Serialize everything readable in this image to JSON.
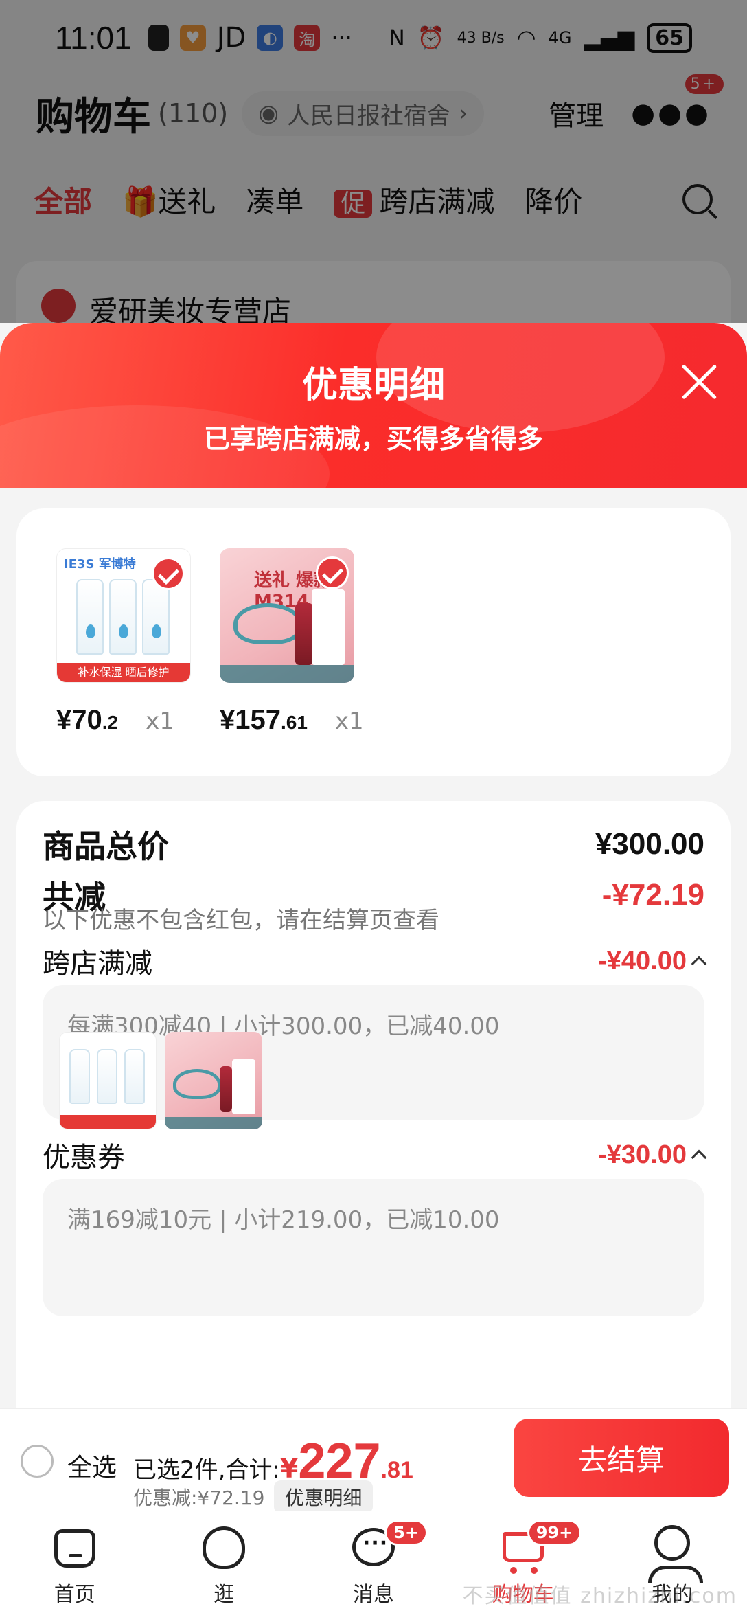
{
  "status_bar": {
    "time": "11:01",
    "app_icons": [
      "JD"
    ],
    "network_speed": "43 B/s",
    "network_type": "4G",
    "battery": "65"
  },
  "cart_header": {
    "title": "购物车",
    "count": "(110)",
    "location": "人民日报社宿舍",
    "manage_label": "管理",
    "more_badge": "5+"
  },
  "cart_tabs": [
    {
      "label": "全部",
      "active": true
    },
    {
      "label": "送礼"
    },
    {
      "label": "凑单"
    },
    {
      "label": "跨店满减",
      "chip": "促"
    },
    {
      "label": "降价"
    }
  ],
  "background_shop": {
    "name": "爱研美妆专营店"
  },
  "sheet": {
    "title": "优惠明细",
    "subtitle": "已享跨店满减，买得多省得多"
  },
  "products": [
    {
      "image": "lotion-tubes",
      "brand_text": "IE3S 军博特",
      "strip_text": "补水保湿 晒后修护",
      "price_int": "¥70",
      "price_dec": ".2",
      "qty": "x1",
      "checked": true
    },
    {
      "image": "lipstick-gift",
      "title_text": "送礼 爆款M314",
      "price_int": "¥157",
      "price_dec": ".61",
      "qty": "x1",
      "checked": true
    }
  ],
  "summary": {
    "total_label": "商品总价",
    "total_value": "¥300.00",
    "reduce_label": "共减",
    "reduce_value": "-¥72.19",
    "note": "以下优惠不包含红包，请在结算页查看"
  },
  "discounts": [
    {
      "label": "跨店满减",
      "value": "-¥40.00",
      "detail": "每满300减40 | 小计300.00，已减40.00"
    },
    {
      "label": "优惠券",
      "value": "-¥30.00",
      "detail": "满169减10元 | 小计219.00，已减10.00"
    }
  ],
  "checkout": {
    "select_all_label": "全选",
    "selected_text": "已选2件,合计:",
    "total_yen": "¥",
    "total_int": "227",
    "total_dec": ".81",
    "saved_text": "优惠减:¥72.19",
    "detail_chip": "优惠明细",
    "button_label": "去结算"
  },
  "bottom_nav": [
    {
      "label": "首页",
      "icon": "home-icon"
    },
    {
      "label": "逛",
      "icon": "stroll-icon"
    },
    {
      "label": "消息",
      "icon": "message-icon",
      "badge": "5+"
    },
    {
      "label": "购物车",
      "icon": "cart-icon",
      "badge": "99+",
      "active": true
    },
    {
      "label": "我的",
      "icon": "profile-icon"
    }
  ],
  "watermark": "不买值值值 zhizhizhi.com",
  "colors": {
    "accent": "#e4393c",
    "header_gradient_start": "#ff5a49",
    "header_gradient_end": "#f52a2e"
  }
}
